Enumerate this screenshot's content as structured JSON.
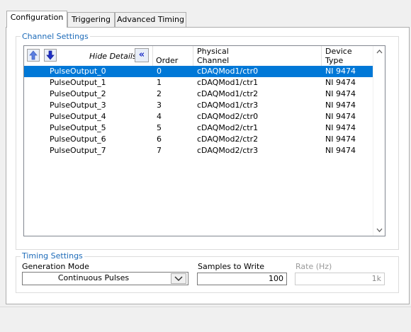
{
  "tabs": [
    {
      "label": "Configuration",
      "active": true
    },
    {
      "label": "Triggering",
      "active": false
    },
    {
      "label": "Advanced Timing",
      "active": false
    }
  ],
  "channel_settings": {
    "title": "Channel Settings",
    "hide_details_label": "Hide Details",
    "move_up_icon": "arrow-up-icon",
    "move_down_icon": "arrow-down-icon",
    "collapse_icon": "double-chevron-left-icon",
    "columns": {
      "order": "Order",
      "physical_channel_line1": "Physical",
      "physical_channel_line2": "Channel",
      "device_type_line1": "Device",
      "device_type_line2": "Type"
    },
    "rows": [
      {
        "name": "PulseOutput_0",
        "order": "0",
        "channel": "cDAQMod1/ctr0",
        "device": "NI 9474",
        "selected": true
      },
      {
        "name": "PulseOutput_1",
        "order": "1",
        "channel": "cDAQMod1/ctr1",
        "device": "NI 9474",
        "selected": false
      },
      {
        "name": "PulseOutput_2",
        "order": "2",
        "channel": "cDAQMod1/ctr2",
        "device": "NI 9474",
        "selected": false
      },
      {
        "name": "PulseOutput_3",
        "order": "3",
        "channel": "cDAQMod1/ctr3",
        "device": "NI 9474",
        "selected": false
      },
      {
        "name": "PulseOutput_4",
        "order": "4",
        "channel": "cDAQMod2/ctr0",
        "device": "NI 9474",
        "selected": false
      },
      {
        "name": "PulseOutput_5",
        "order": "5",
        "channel": "cDAQMod2/ctr1",
        "device": "NI 9474",
        "selected": false
      },
      {
        "name": "PulseOutput_6",
        "order": "6",
        "channel": "cDAQMod2/ctr2",
        "device": "NI 9474",
        "selected": false
      },
      {
        "name": "PulseOutput_7",
        "order": "7",
        "channel": "cDAQMod2/ctr3",
        "device": "NI 9474",
        "selected": false
      }
    ]
  },
  "timing_settings": {
    "title": "Timing Settings",
    "generation_mode_label": "Generation Mode",
    "generation_mode_value": "Continuous Pulses",
    "samples_label": "Samples to Write",
    "samples_value": "100",
    "rate_label": "Rate (Hz)",
    "rate_value": "1k"
  },
  "colors": {
    "accent": "#1c6ab8",
    "selection": "#0078d7"
  }
}
